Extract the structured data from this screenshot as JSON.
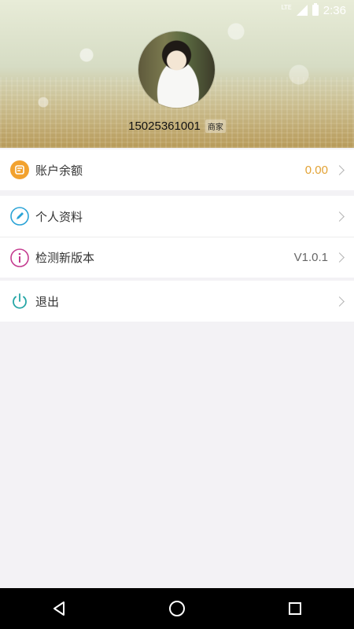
{
  "status_bar": {
    "network": "LTE",
    "time": "2:36"
  },
  "profile": {
    "phone": "15025361001",
    "role_tag": "商家"
  },
  "menu": {
    "balance": {
      "label": "账户余额",
      "value": "0.00",
      "icon": "wallet-icon"
    },
    "profile": {
      "label": "个人资料",
      "icon": "pencil-icon"
    },
    "check_version": {
      "label": "检测新版本",
      "value": "V1.0.1",
      "icon": "info-icon"
    },
    "logout": {
      "label": "退出",
      "icon": "power-icon"
    }
  },
  "colors": {
    "balance_value": "#e2a234",
    "balance_icon": "#f2a22f",
    "profile_icon": "#2aa3d6",
    "version_icon": "#c43a8f",
    "logout_icon": "#26a6a6"
  },
  "navigation": {
    "back": "back-icon",
    "home": "home-icon",
    "recents": "recents-icon"
  }
}
